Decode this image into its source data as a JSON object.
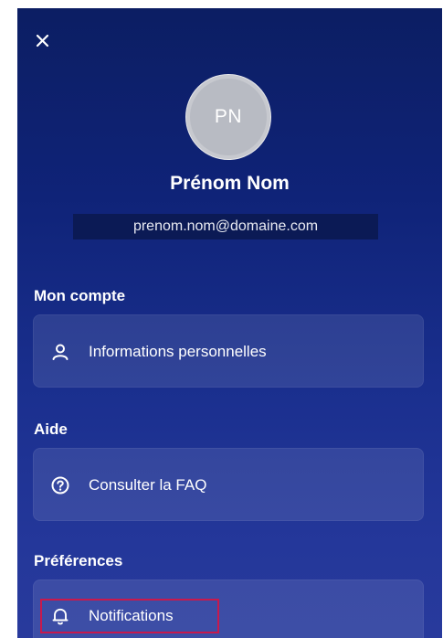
{
  "profile": {
    "initials": "PN",
    "name": "Prénom Nom",
    "email": "prenom.nom@domaine.com"
  },
  "sections": {
    "account": {
      "title": "Mon compte",
      "item_label": "Informations personnelles",
      "item_icon": "user-icon"
    },
    "help": {
      "title": "Aide",
      "item_label": "Consulter la FAQ",
      "item_icon": "help-circle-icon"
    },
    "preferences": {
      "title": "Préférences",
      "item_label": "Notifications",
      "item_icon": "bell-icon"
    }
  },
  "icons": {
    "close": "close-icon"
  },
  "colors": {
    "background_top": "#0c1e63",
    "background_bottom": "#283a9c",
    "highlight": "#c8194d",
    "avatar": "#b8bbc3"
  }
}
